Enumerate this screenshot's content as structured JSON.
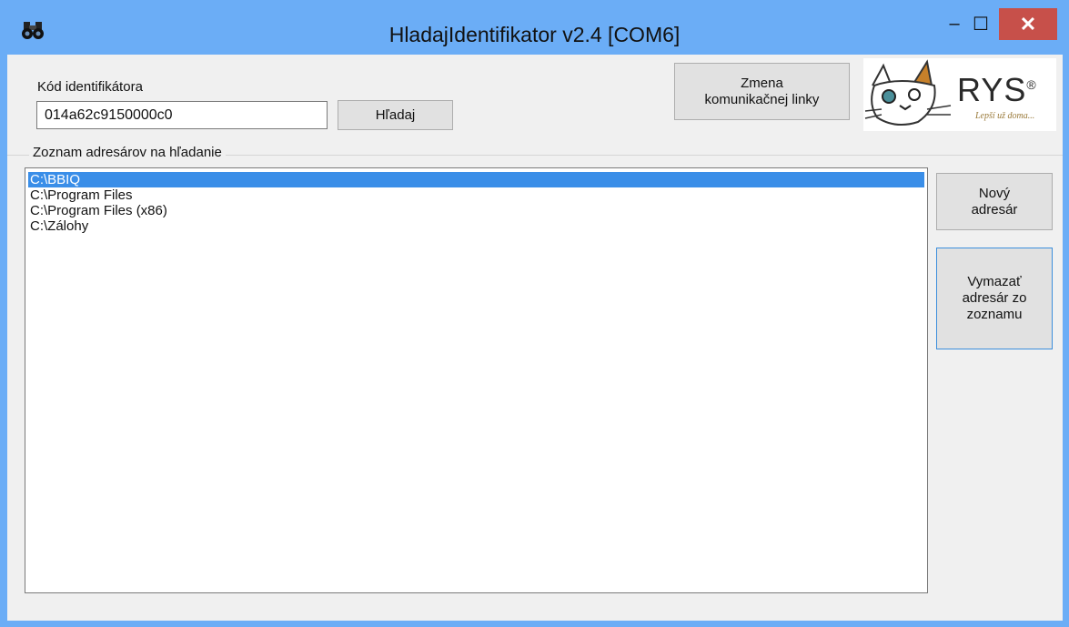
{
  "window": {
    "title": "HladajIdentifikator v2.4 [COM6]",
    "controls": {
      "minimize": "–",
      "maximize": "☐",
      "close": "✕"
    },
    "accent_color": "#6badf6",
    "close_color": "#c7504a"
  },
  "form": {
    "code_label": "Kód identifikátora",
    "code_value": "014a62c9150000c0",
    "search_button": "Hľadaj",
    "change_link_button_line1": "Zmena",
    "change_link_button_line2": "komunikačnej linky",
    "group_label": "Zoznam adresárov na hľadanie",
    "new_dir_line1": "Nový",
    "new_dir_line2": "adresár",
    "delete_dir_line1": "Vymazať",
    "delete_dir_line2": "adresár zo",
    "delete_dir_line3": "zoznamu"
  },
  "logo": {
    "brand": "RYS",
    "brand_mark": "®",
    "slogan": "Lepší už doma..."
  },
  "directories": [
    {
      "path": "C:\\BBIQ",
      "selected": true
    },
    {
      "path": "C:\\Program Files",
      "selected": false
    },
    {
      "path": "C:\\Program Files (x86)",
      "selected": false
    },
    {
      "path": "C:\\Zálohy",
      "selected": false
    }
  ]
}
